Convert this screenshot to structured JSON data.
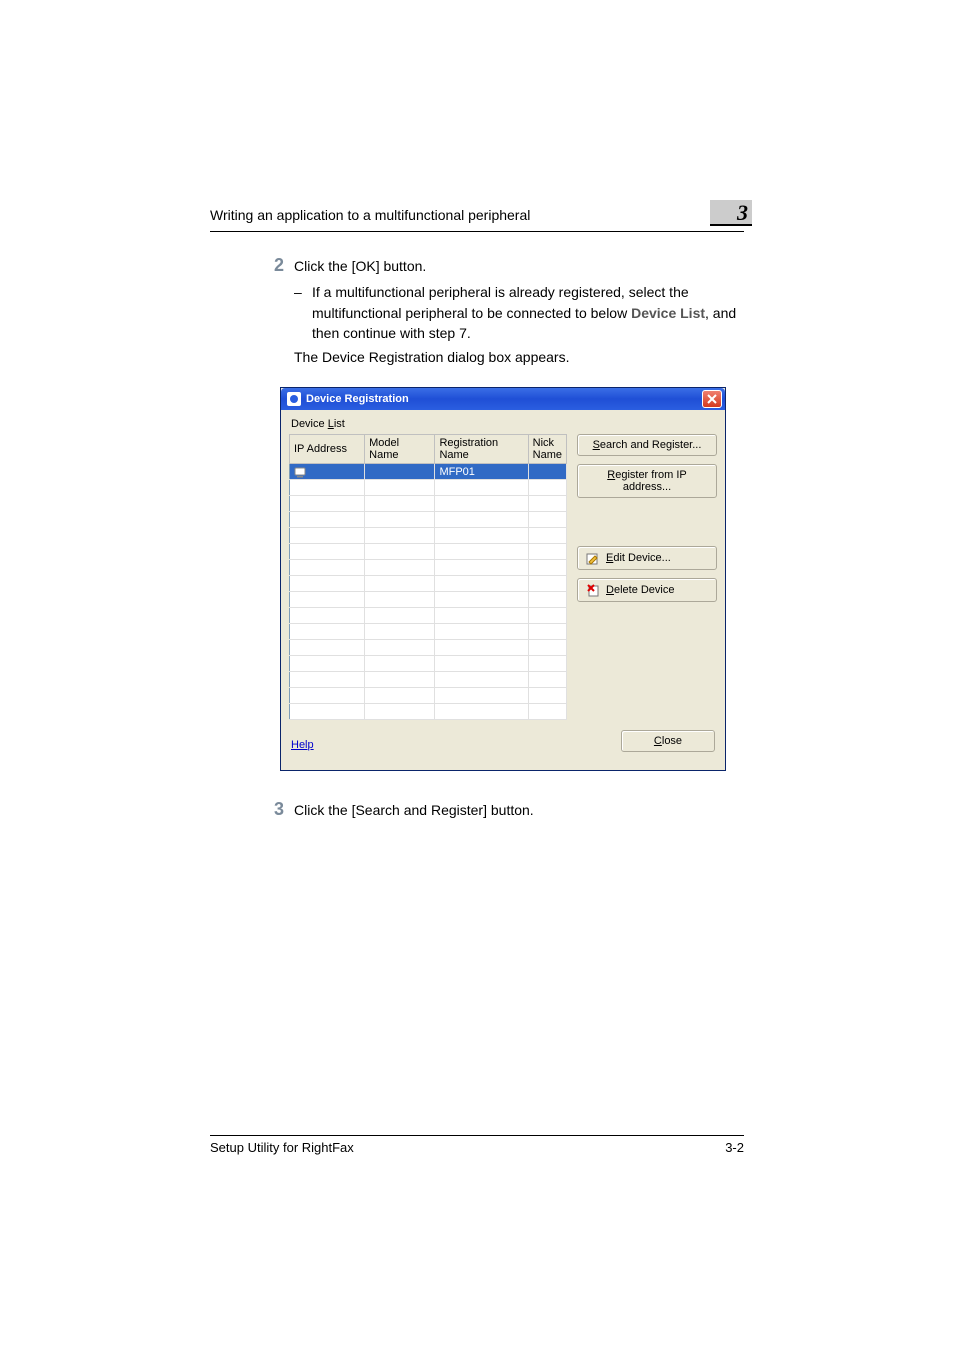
{
  "header": {
    "running_title": "Writing an application to a multifunctional peripheral",
    "chapter_number": "3"
  },
  "steps": {
    "s2": {
      "num": "2",
      "text": "Click the [OK] button.",
      "sub_dash": "–",
      "sub_text_before": "If a multifunctional peripheral is already registered, select the multifunctional peripheral to be connected to below ",
      "sub_bold": "Device List",
      "sub_text_after": ", and then continue with step 7.",
      "result": "The Device Registration dialog box appears."
    },
    "s3": {
      "num": "3",
      "text": "Click the [Search and Register] button."
    }
  },
  "dialog": {
    "title": "Device Registration",
    "list_label_pre": "Device ",
    "list_label_u": "L",
    "list_label_post": "ist",
    "columns": {
      "ip": "IP Address",
      "model": "Model Name",
      "reg": "Registration Name",
      "nick": "Nick Name"
    },
    "row1": {
      "ip": "",
      "model": "",
      "reg": "MFP01",
      "nick": ""
    },
    "buttons": {
      "search_u": "S",
      "search_rest": "earch and Register...",
      "regip_u": "R",
      "regip_rest": "egister from IP address...",
      "edit_u": "E",
      "edit_rest": "dit Device...",
      "delete_u": "D",
      "delete_rest": "elete Device",
      "help_u": "p",
      "help_pre": "Hel",
      "close_u": "C",
      "close_rest": "lose"
    }
  },
  "footer": {
    "left": "Setup Utility for RightFax",
    "right": "3-2"
  }
}
